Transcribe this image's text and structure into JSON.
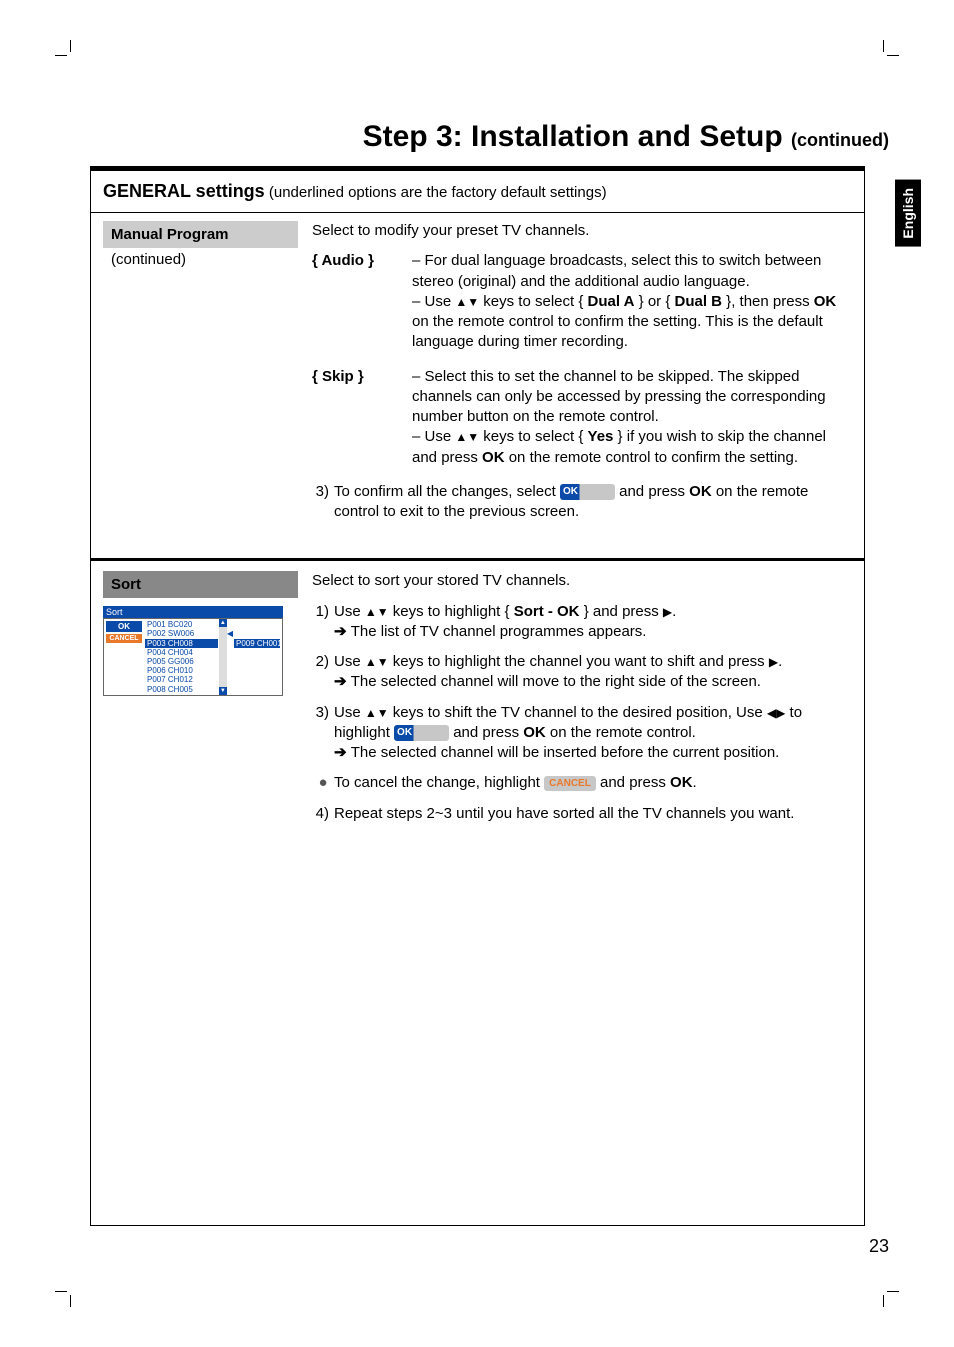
{
  "page": {
    "title_main": "Step 3: Installation and Setup ",
    "title_cont": "(continued)",
    "side_tab": "English",
    "number": "23"
  },
  "header": {
    "bold": "GENERAL settings",
    "rest": " (underlined options are the factory default settings)"
  },
  "manual": {
    "label": "Manual Program",
    "sub": "(continued)",
    "intro": "Select to modify your preset TV channels.",
    "audio": {
      "key": "{ Audio }",
      "l1": "– For dual language broadcasts, select this to switch between stereo (original) and the additional audio language.",
      "l2a": "– Use ",
      "l2b": " keys to select { ",
      "l2c": "Dual A",
      "l2d": " } or { ",
      "l2e": "Dual B",
      "l2f": " }, then press ",
      "l2g": "OK",
      "l2h": " on the remote control to confirm the setting. This is the default language during timer recording."
    },
    "skip": {
      "key": "{ Skip }",
      "l1": "– Select this to set the channel to be skipped. The skipped channels can only be accessed by pressing the corresponding number button on the remote control.",
      "l2a": "– Use ",
      "l2b": " keys to select { ",
      "l2c": "Yes",
      "l2d": " } if you wish to skip the channel and press ",
      "l2e": "OK",
      "l2f": " on the remote control to confirm the setting."
    },
    "step3": {
      "n": "3)",
      "a": "To confirm all the changes, select ",
      "ok_badge": "OK",
      "b": " and press ",
      "c": "OK",
      "d": " on the remote control to exit to the previous screen."
    }
  },
  "sort": {
    "label": "Sort",
    "intro": "Select to sort your stored TV channels.",
    "s1": {
      "n": "1)",
      "a": "Use ",
      "b": " keys to highlight  { ",
      "c": "Sort - OK",
      "d": " } and press ",
      "e": ".",
      "res": " The list of TV channel programmes appears."
    },
    "s2": {
      "n": "2)",
      "a": "Use ",
      "b": " keys to highlight the channel you want to shift and press ",
      "c": ".",
      "res": " The selected channel will move to the right side of the screen."
    },
    "s3": {
      "n": "3)",
      "a": "Use ",
      "b": " keys to shift the TV channel to the desired position, Use ",
      "c": " to highlight ",
      "ok_badge": "OK",
      "d": " and press ",
      "e": "OK",
      "f": " on the remote control.",
      "res": " The selected channel will be inserted before the current position."
    },
    "bullet": {
      "a": "To cancel the change, highlight ",
      "cancel_badge": "CANCEL",
      "b": " and press ",
      "c": "OK",
      "d": "."
    },
    "s4": {
      "n": "4)",
      "t": "Repeat steps 2~3 until you have sorted all the TV channels you want."
    }
  },
  "osd": {
    "title": "Sort",
    "ok": "OK",
    "cancel": "CANCEL",
    "rows": [
      "P001 BC020",
      "P002 SW006",
      "P003 CH008",
      "P004 CH004",
      "P005 GG006",
      "P006 CH010",
      "P007 CH012",
      "P008 CH005"
    ],
    "pick": "P009 CH001"
  }
}
